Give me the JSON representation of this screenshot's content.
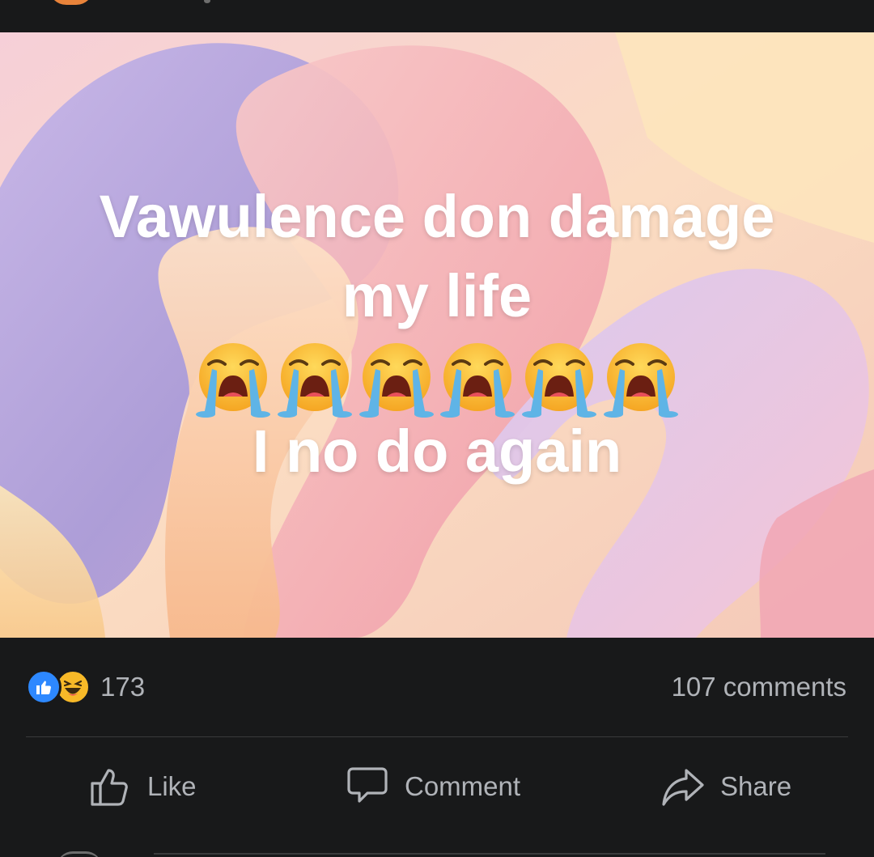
{
  "post": {
    "text_line1": "Vawulence don damage",
    "text_line2": "my life",
    "emoji_row": "😭😭😭😭😭😭",
    "text_line3": "I no do again",
    "emoji_count": 6,
    "emoji_icon": "loudly-crying-face-icon"
  },
  "reactions": {
    "count": "173",
    "icons": [
      "like-reaction-icon",
      "haha-reaction-icon"
    ],
    "like_color": "#2d88ff",
    "haha_color": "#f7b928"
  },
  "comments": {
    "count_text": "107 comments"
  },
  "actions": {
    "like_label": "Like",
    "comment_label": "Comment",
    "share_label": "Share"
  },
  "theme": {
    "background": "#18191a",
    "text_secondary": "#b0b3b8",
    "divider": "#3a3b3c"
  }
}
